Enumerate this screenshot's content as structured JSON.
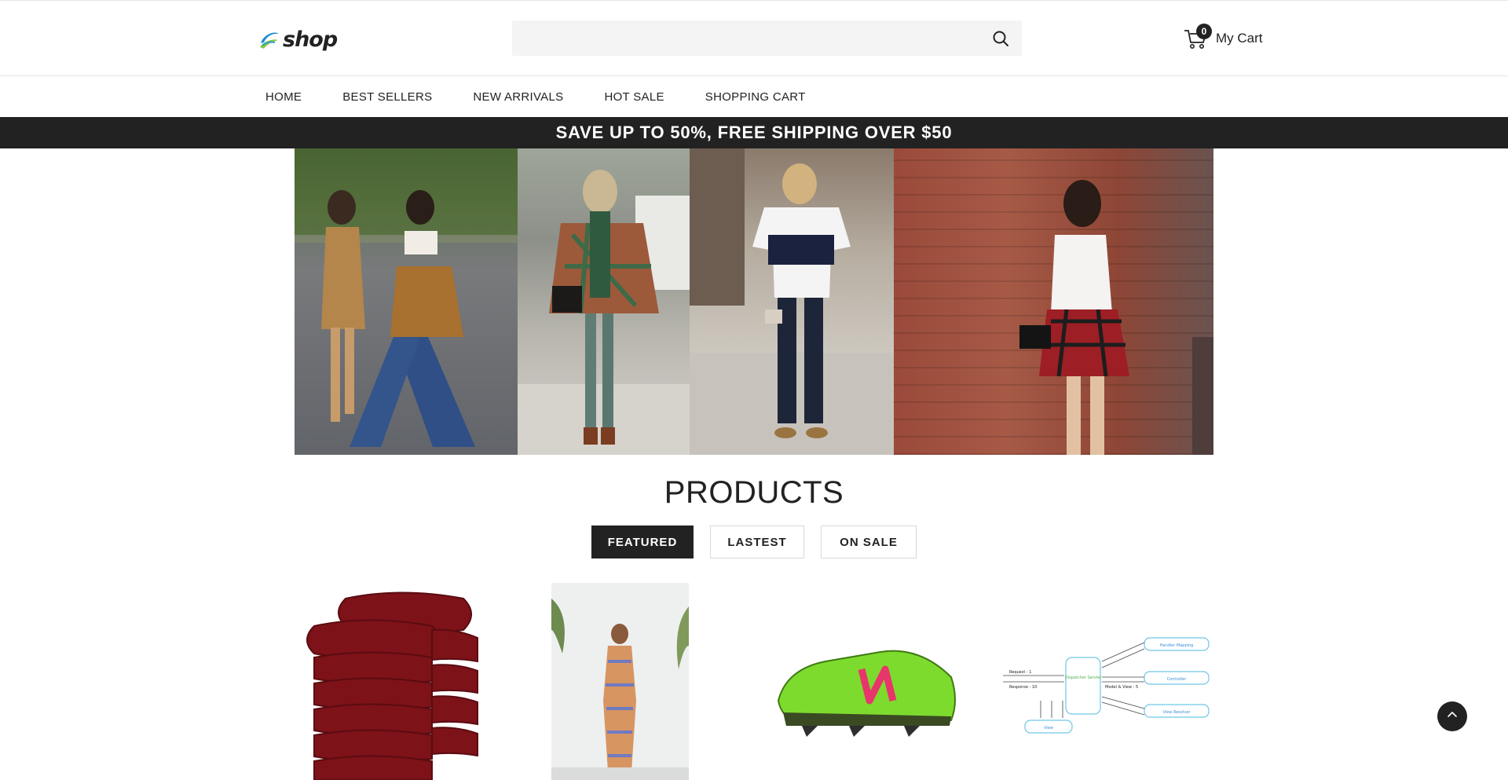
{
  "header": {
    "logo_text": "shop",
    "search": {
      "value": "",
      "placeholder": ""
    },
    "cart": {
      "count": "0",
      "label": "My Cart"
    }
  },
  "nav": {
    "items": [
      {
        "label": "HOME"
      },
      {
        "label": "BEST SELLERS"
      },
      {
        "label": "NEW ARRIVALS"
      },
      {
        "label": "HOT SALE"
      },
      {
        "label": "SHOPPING CART"
      }
    ]
  },
  "promo": {
    "text": "SAVE UP TO 50%, FREE SHIPPING OVER $50"
  },
  "products": {
    "title": "PRODUCTS",
    "tabs": [
      {
        "label": "FEATURED",
        "active": true
      },
      {
        "label": "LASTEST",
        "active": false
      },
      {
        "label": "ON SALE",
        "active": false
      }
    ]
  },
  "diagram_labels": {
    "center": "Dispatcher Servlet",
    "handler": "Handler Mapping",
    "controller": "Controller",
    "view_resolver": "View Resolver",
    "view": "View",
    "request": "Request - 1",
    "response": "Response - 10",
    "model": "Model & View - 5"
  },
  "colors": {
    "dark": "#222222",
    "search_bg": "#f4f4f4",
    "logo_blue": "#1f8ad6",
    "logo_green": "#8cc63f"
  },
  "icons": {
    "search": "search-icon",
    "cart": "shopping-cart-icon",
    "back_to_top": "chevron-up-icon"
  }
}
